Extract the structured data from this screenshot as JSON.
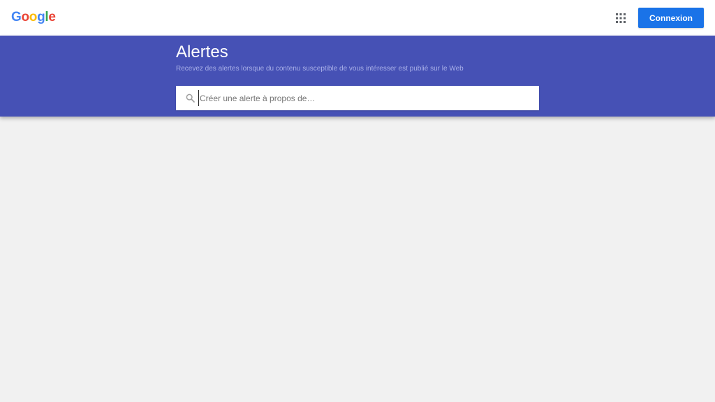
{
  "header": {
    "logo_letters": [
      {
        "char": "G",
        "color": "#4285f4"
      },
      {
        "char": "o",
        "color": "#ea4335"
      },
      {
        "char": "o",
        "color": "#fbbc05"
      },
      {
        "char": "g",
        "color": "#4285f4"
      },
      {
        "char": "l",
        "color": "#34a853"
      },
      {
        "char": "e",
        "color": "#ea4335"
      }
    ],
    "apps_icon": "apps-grid-icon",
    "signin_label": "Connexion",
    "signin_color": "#1a73e8"
  },
  "hero": {
    "background": "#4651b5",
    "title": "Alertes",
    "subtitle": "Recevez des alertes lorsque du contenu susceptible de vous intéresser est publié sur le Web"
  },
  "search": {
    "icon": "search-icon",
    "value": "",
    "placeholder": "Créer une alerte à propos de…"
  }
}
